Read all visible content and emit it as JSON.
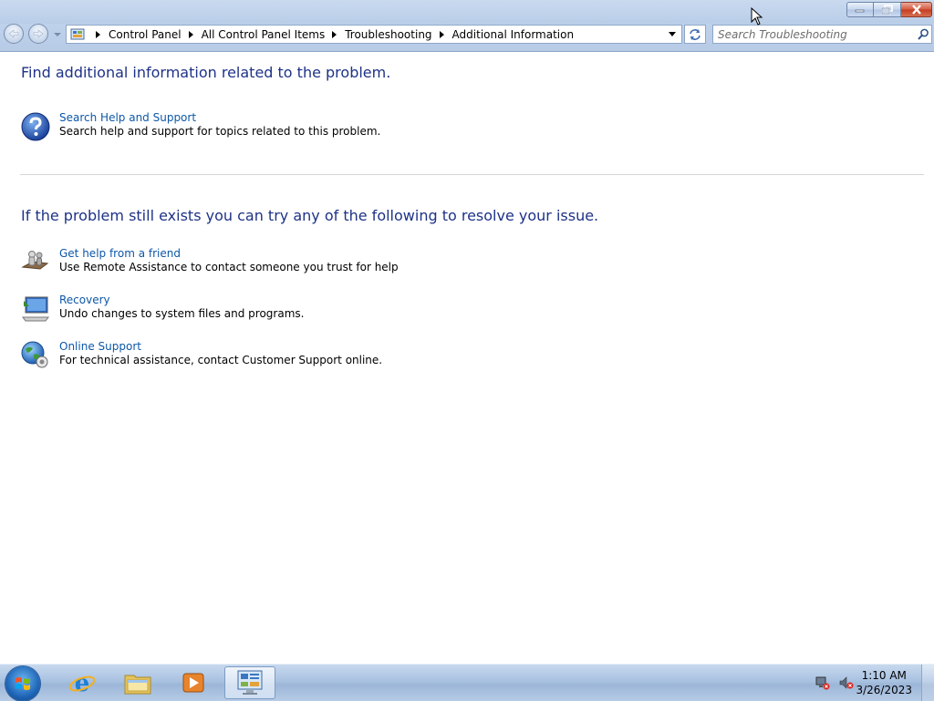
{
  "window": {
    "caption_buttons": {
      "minimize": "minimize",
      "maximize": "restore",
      "close": "close"
    }
  },
  "address_bar": {
    "icon": "control-panel-icon",
    "breadcrumbs": [
      "Control Panel",
      "All Control Panel Items",
      "Troubleshooting",
      "Additional Information"
    ]
  },
  "search": {
    "placeholder": "Search Troubleshooting"
  },
  "section1": {
    "heading": "Find additional information related to the problem.",
    "items": [
      {
        "icon": "help-question-icon",
        "title": "Search Help and Support",
        "description": "Search help and support for topics related to this problem."
      }
    ]
  },
  "section2": {
    "heading": "If the problem still exists you can try any of the following to resolve your issue.",
    "items": [
      {
        "icon": "remote-assistance-icon",
        "title": "Get help from a friend",
        "description": "Use Remote Assistance to contact someone you trust for help"
      },
      {
        "icon": "recovery-icon",
        "title": "Recovery",
        "description": "Undo changes to system files and programs."
      },
      {
        "icon": "globe-support-icon",
        "title": "Online Support",
        "description": "For technical assistance, contact Customer Support online."
      }
    ]
  },
  "taskbar": {
    "pinned": [
      "internet-explorer-icon",
      "windows-explorer-icon",
      "media-player-icon",
      "control-panel-icon"
    ],
    "clock": {
      "time": "1:10 AM",
      "date": "3/26/2023"
    }
  },
  "colors": {
    "heading": "#1e3287",
    "link": "#0d57a8"
  }
}
